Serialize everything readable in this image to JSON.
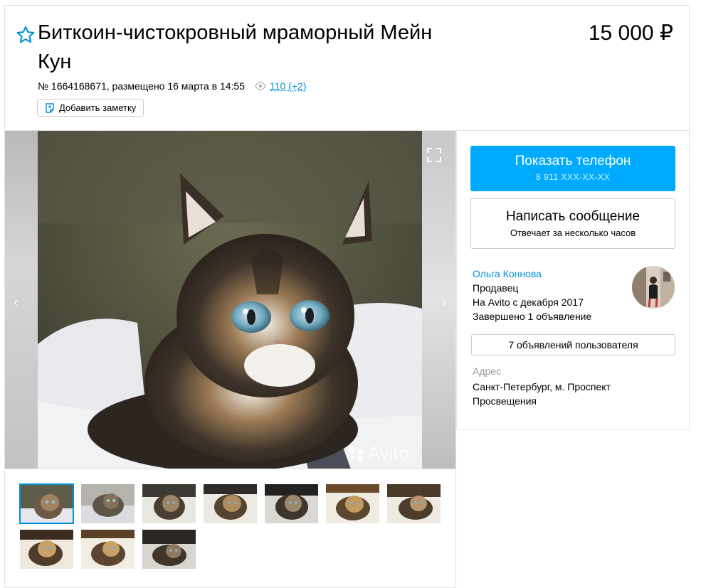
{
  "listing": {
    "title": "Биткоин-чистокровный мраморный Мейн Кун",
    "price": "15 000 ₽",
    "meta_text": "№ 1664168671, размещено 16 марта в 14:55",
    "views": "110 (+2)",
    "add_note_label": "Добавить заметку"
  },
  "gallery": {
    "watermark": "Avito",
    "thumb_count": 10,
    "active_thumb": 1
  },
  "contact": {
    "phone_label": "Показать телефон",
    "phone_masked": "8 911 XXX-XX-XX",
    "message_label": "Написать сообщение",
    "message_sub": "Отвечает за несколько часов"
  },
  "seller": {
    "name": "Ольга Коннова",
    "role": "Продавец",
    "since": "На Avito с декабря 2017",
    "completed": "Завершено 1 объявление",
    "ads_button": "7 объявлений пользователя"
  },
  "address": {
    "label": "Адрес",
    "value": "Санкт-Петербург, м. Проспект Просвещения"
  },
  "colors": {
    "accent": "#00aaff",
    "link": "#0091d9"
  },
  "icons": [
    "star-icon",
    "eye-icon",
    "note-icon",
    "fullscreen-icon",
    "arrow-left-icon",
    "arrow-right-icon"
  ]
}
